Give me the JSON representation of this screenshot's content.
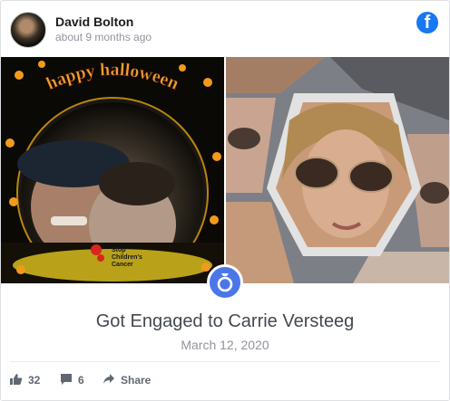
{
  "post": {
    "author": "David Bolton",
    "time": "about 9 months ago",
    "platform_icon": "facebook-icon",
    "brand_color": "#1877f2"
  },
  "left_photo": {
    "overlay_title": "happy halloween",
    "logo_text_1": "Stop",
    "logo_text_2": "Children's",
    "logo_text_3": "Cancer"
  },
  "event": {
    "icon": "ring-icon",
    "title": "Got Engaged to Carrie Versteeg",
    "date": "March 12, 2020",
    "badge_color": "#4a76e8"
  },
  "actions": {
    "likes": "32",
    "comments": "6",
    "share_label": "Share"
  }
}
